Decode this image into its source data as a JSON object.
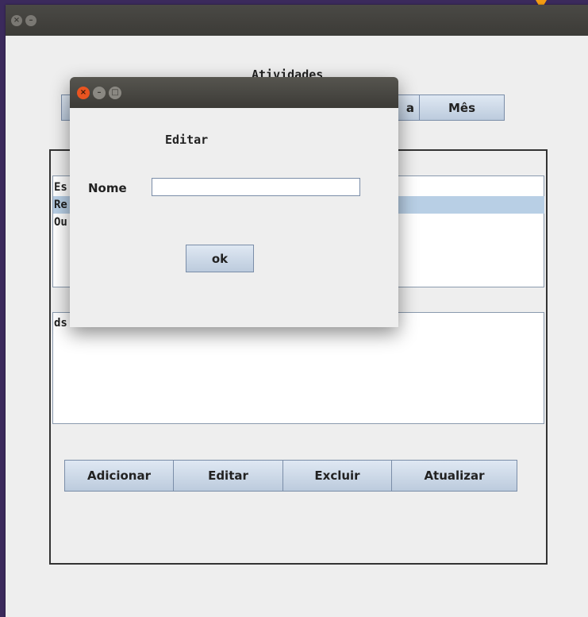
{
  "main_window": {
    "title": "",
    "heading": "Atividades",
    "tabs": [
      {
        "label": ""
      },
      {
        "label": "a"
      },
      {
        "label": "Mês"
      }
    ],
    "activity_list": [
      {
        "label": "Es"
      },
      {
        "label": "Re"
      },
      {
        "label": "Ou"
      }
    ],
    "detail_text": "ds",
    "actions": {
      "add_label": "Adicionar",
      "edit_label": "Editar",
      "delete_label": "Excluir",
      "refresh_label": "Atualizar"
    }
  },
  "dialog": {
    "title": "",
    "heading": "Editar",
    "name_label": "Nome",
    "name_value": "",
    "ok_label": "ok"
  },
  "colors": {
    "desktop_background": "#3b2a5c",
    "titlebar": "#3c3b37",
    "window_background": "#eeeeee",
    "selection": "#b8cfe5",
    "close_button": "#e95420"
  }
}
